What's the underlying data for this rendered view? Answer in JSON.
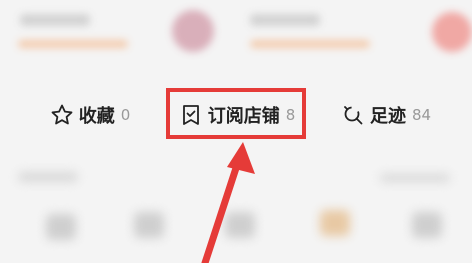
{
  "stats": {
    "favorites": {
      "label": "收藏",
      "count": "0",
      "icon": "star-icon"
    },
    "subscribed_stores": {
      "label": "订阅店铺",
      "count": "8",
      "icon": "bookmark-store-icon"
    },
    "footprints": {
      "label": "足迹",
      "count": "84",
      "icon": "footprint-icon"
    }
  },
  "annotation": {
    "color": "#e53b38"
  }
}
